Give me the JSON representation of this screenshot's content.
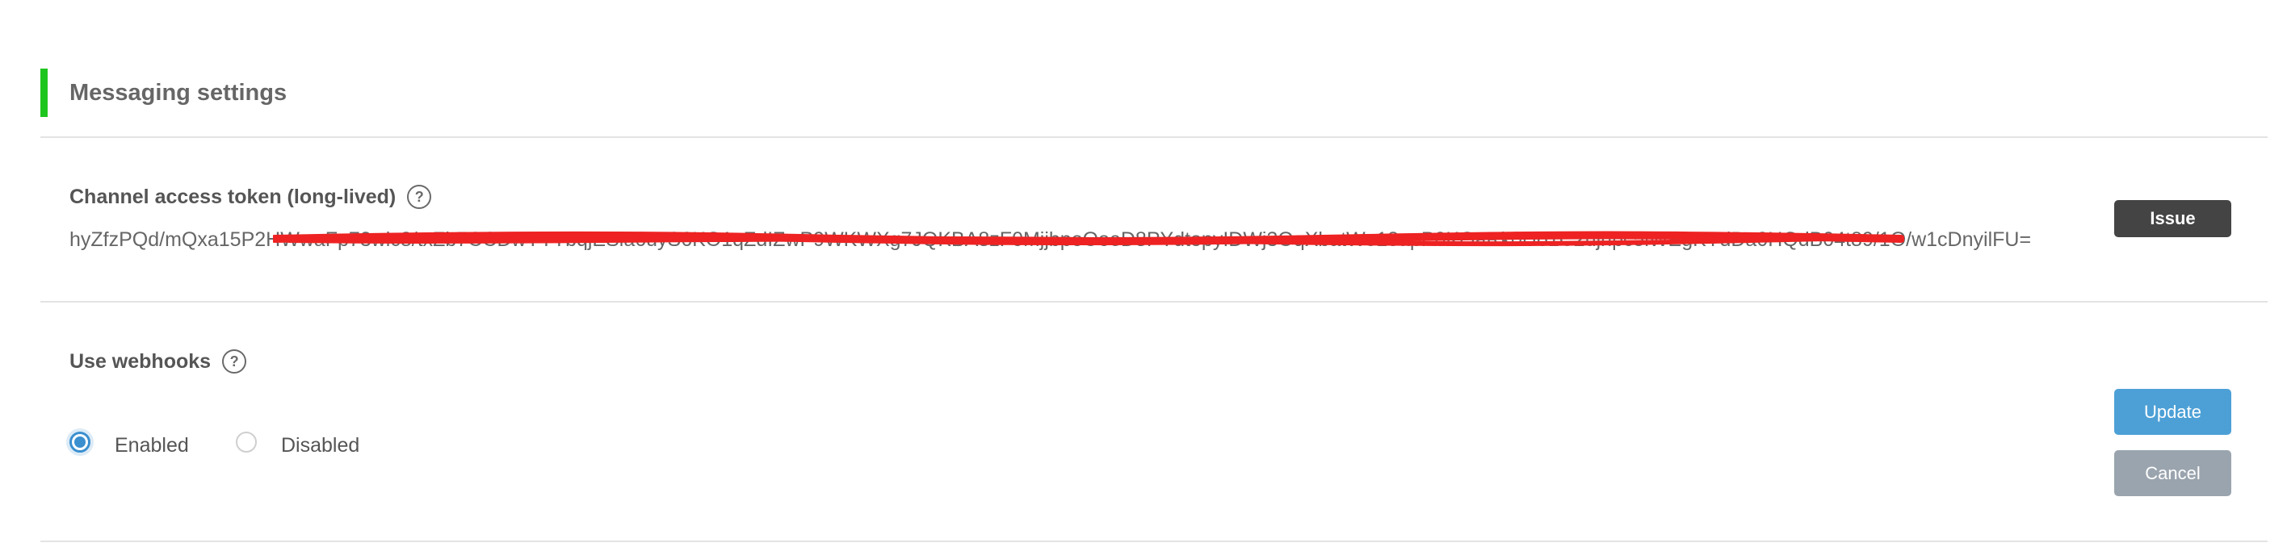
{
  "section": {
    "title": "Messaging settings",
    "accent_color": "#1fc51f"
  },
  "access_token": {
    "label": "Channel access token (long-lived)",
    "help_icon": "question-circle-icon",
    "help_glyph": "?",
    "value": "hyZfzPQd/mQxa15P2HWwaFp73wlc8/txZb7CCDwYYTbqjESla6uyS6KO1qZdIZwP9WKWXg7JQKBA8zF0MjjbpoOoeD8PYdtopyIDWj3OqXbatWe18apP0KOaRk0Uo1C2ujhpc5lWEgKYdDa0HQdB04t89/1O/w1cDnyilFU=",
    "redacted": true,
    "redaction_color": "#ee2222",
    "issue_button_label": "Issue"
  },
  "webhooks": {
    "label": "Use webhooks",
    "help_icon": "question-circle-icon",
    "help_glyph": "?",
    "options": [
      {
        "label": "Enabled",
        "selected": true
      },
      {
        "label": "Disabled",
        "selected": false
      }
    ],
    "update_button_label": "Update",
    "cancel_button_label": "Cancel",
    "update_color": "#4da0d6",
    "cancel_color": "#9aa4ae"
  }
}
